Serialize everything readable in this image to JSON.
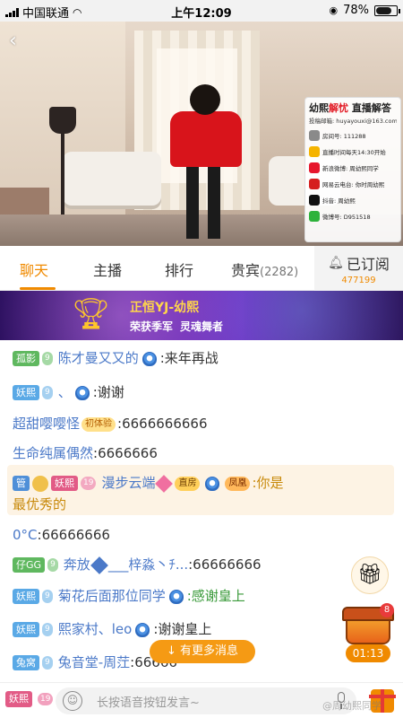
{
  "status_bar": {
    "carrier": "中国联通",
    "time": "上午12:09",
    "battery": "78%",
    "battery_level": 0.78
  },
  "video": {
    "info_board": {
      "title_prefix": "幼熙",
      "title_highlight": "解忧",
      "title_suffix": " 直播解答",
      "email": "投稿邮箱: huyayouxi@163.com",
      "rows": [
        {
          "icon": "room-icon",
          "color": "#8a8a8a",
          "text": "房间号: 111288"
        },
        {
          "icon": "clock-icon",
          "color": "#f5b400",
          "text": "直播时间每天14:30开始"
        },
        {
          "icon": "weibo-icon",
          "color": "#e6162d",
          "text": "新浪微博: 周幼熙同学"
        },
        {
          "icon": "netease-music-icon",
          "color": "#d51f1f",
          "text": "网易云电台: 你时周幼熙"
        },
        {
          "icon": "douyin-icon",
          "color": "#111111",
          "text": "抖音: 周幼熙"
        },
        {
          "icon": "wechat-icon",
          "color": "#2db23b",
          "text": "微博号: D951518"
        }
      ]
    }
  },
  "tabs": {
    "chat": "聊天",
    "host": "主播",
    "rank": "排行",
    "guests": "贵宾",
    "guests_count": "(2282)",
    "subscribe_label": "已订阅",
    "subscribe_count": "477199"
  },
  "banner": {
    "line1": "正恒YJ-幼熙",
    "line2a": "荣获季军",
    "line2b": "灵魂舞者"
  },
  "chat": {
    "m1": {
      "badge": "孤影",
      "level": "9",
      "name": "陈才曼又又的",
      "text": ":来年再战"
    },
    "m2": {
      "badge": "妖熙",
      "level": "9",
      "name": "、",
      "text": ":谢谢"
    },
    "m3": {
      "name": "超甜嘤嘤怪",
      "tag": "初体验",
      "text": ":6666666666"
    },
    "m4": {
      "name": "生命纯属偶然",
      "text": ":6666666"
    },
    "m5": {
      "role": "管",
      "badge": "妖熙",
      "level": "19",
      "name": "漫步云端",
      "tag1": "直房",
      "tag2": "凤凰",
      "text1": ":你是",
      "text2": "最优秀的"
    },
    "m6": {
      "name": "0°C",
      "text": ":66666666"
    },
    "m7": {
      "badge": "仔GG",
      "level": "9",
      "name": "奔放",
      "name2": "___梓淼丶ﾁ...",
      "text": ":66666666"
    },
    "m8": {
      "badge": "妖熙",
      "level": "9",
      "name": "菊花后面那位同学",
      "text": ":感谢皇上"
    },
    "m9": {
      "badge": "妖熙",
      "level": "9",
      "name": "熙家村、leo",
      "text": ":谢谢皇上"
    },
    "m10": {
      "badge": "兔窝",
      "level": "9",
      "name": "兔音堂-周茳",
      "text": ":66666"
    },
    "more_messages": "↓ 有更多消息",
    "gift_count": "8",
    "gift_timer": "01:13"
  },
  "input": {
    "badge": "妖熙",
    "level": "19",
    "placeholder": "长按语音按钮发言~"
  },
  "watermark": "@周幼熙同学"
}
